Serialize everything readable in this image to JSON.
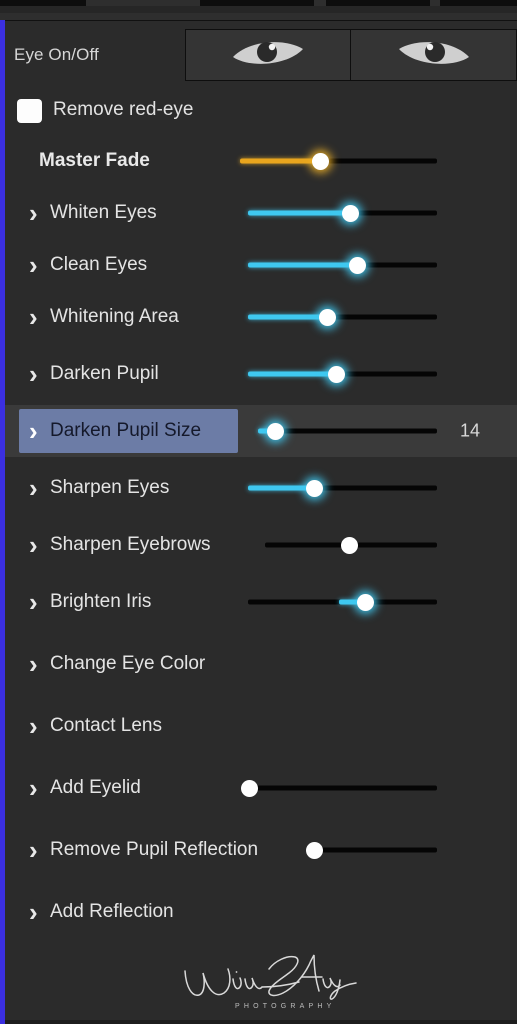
{
  "panel": {
    "title": "Eye On/Off",
    "background_color": "#2b2b2b",
    "accent_strip_color": "#3b2fe0",
    "slider_active_color": "#3fc8f0",
    "master_slider_color": "#e8a51e",
    "selected_chip_color": "#6c7ca6"
  },
  "eye_toggles": [
    {
      "name": "left-eye-toggle",
      "icon": "eye-icon-left",
      "enabled": true
    },
    {
      "name": "right-eye-toggle",
      "icon": "eye-icon-right",
      "enabled": true
    }
  ],
  "checkbox": {
    "label": "Remove red-eye",
    "checked": false
  },
  "controls": [
    {
      "label": "Master Fade",
      "bold": true,
      "expandable": false,
      "has_slider": true,
      "slider": {
        "percent": 41,
        "color": "gold",
        "track_start": 240,
        "track_end": 437
      },
      "value": ""
    },
    {
      "label": "Whiten Eyes",
      "bold": false,
      "expandable": true,
      "has_slider": true,
      "slider": {
        "percent": 54,
        "color": "cyan",
        "track_start": 248,
        "track_end": 437
      },
      "value": ""
    },
    {
      "label": "Clean Eyes",
      "bold": false,
      "expandable": true,
      "has_slider": true,
      "slider": {
        "percent": 58,
        "color": "cyan",
        "track_start": 248,
        "track_end": 437
      },
      "value": ""
    },
    {
      "label": "Whitening Area",
      "bold": false,
      "expandable": true,
      "has_slider": true,
      "slider": {
        "percent": 42,
        "color": "cyan",
        "track_start": 248,
        "track_end": 437
      },
      "value": ""
    },
    {
      "label": "Darken Pupil",
      "bold": false,
      "expandable": true,
      "has_slider": true,
      "slider": {
        "percent": 47,
        "color": "cyan",
        "track_start": 248,
        "track_end": 437
      },
      "value": ""
    },
    {
      "label": "Darken Pupil Size",
      "bold": false,
      "expandable": true,
      "selected": true,
      "has_slider": true,
      "slider": {
        "percent": 10,
        "color": "cyan",
        "track_start": 258,
        "track_end": 437
      },
      "value": "14"
    },
    {
      "label": "Sharpen Eyes",
      "bold": false,
      "expandable": true,
      "has_slider": true,
      "slider": {
        "percent": 35,
        "color": "cyan",
        "track_start": 248,
        "track_end": 437
      },
      "value": ""
    },
    {
      "label": "Sharpen Eyebrows",
      "bold": false,
      "expandable": true,
      "has_slider": true,
      "slider": {
        "percent": 49,
        "color": "none",
        "track_start": 265,
        "track_end": 437
      },
      "value": ""
    },
    {
      "label": "Brighten Iris",
      "bold": false,
      "expandable": true,
      "has_slider": true,
      "slider": {
        "percent": 62,
        "color": "cyan-short",
        "track_start": 248,
        "track_end": 437
      },
      "value": ""
    },
    {
      "label": "Change Eye Color",
      "bold": false,
      "expandable": true,
      "has_slider": false,
      "value": ""
    },
    {
      "label": "Contact Lens",
      "bold": false,
      "expandable": true,
      "has_slider": false,
      "value": ""
    },
    {
      "label": "Add Eyelid",
      "bold": false,
      "expandable": true,
      "has_slider": true,
      "slider": {
        "percent": 1,
        "color": "none",
        "track_start": 248,
        "track_end": 437
      },
      "value": ""
    },
    {
      "label": "Remove Pupil Reflection",
      "bold": false,
      "expandable": true,
      "has_slider": true,
      "slider": {
        "percent": 2,
        "color": "none",
        "track_start": 312,
        "track_end": 437
      },
      "value": ""
    },
    {
      "label": "Add Reflection",
      "bold": false,
      "expandable": true,
      "has_slider": false,
      "value": ""
    }
  ],
  "watermark": {
    "signature": "Jim Arys",
    "subtitle": "PHOTOGRAPHY"
  }
}
